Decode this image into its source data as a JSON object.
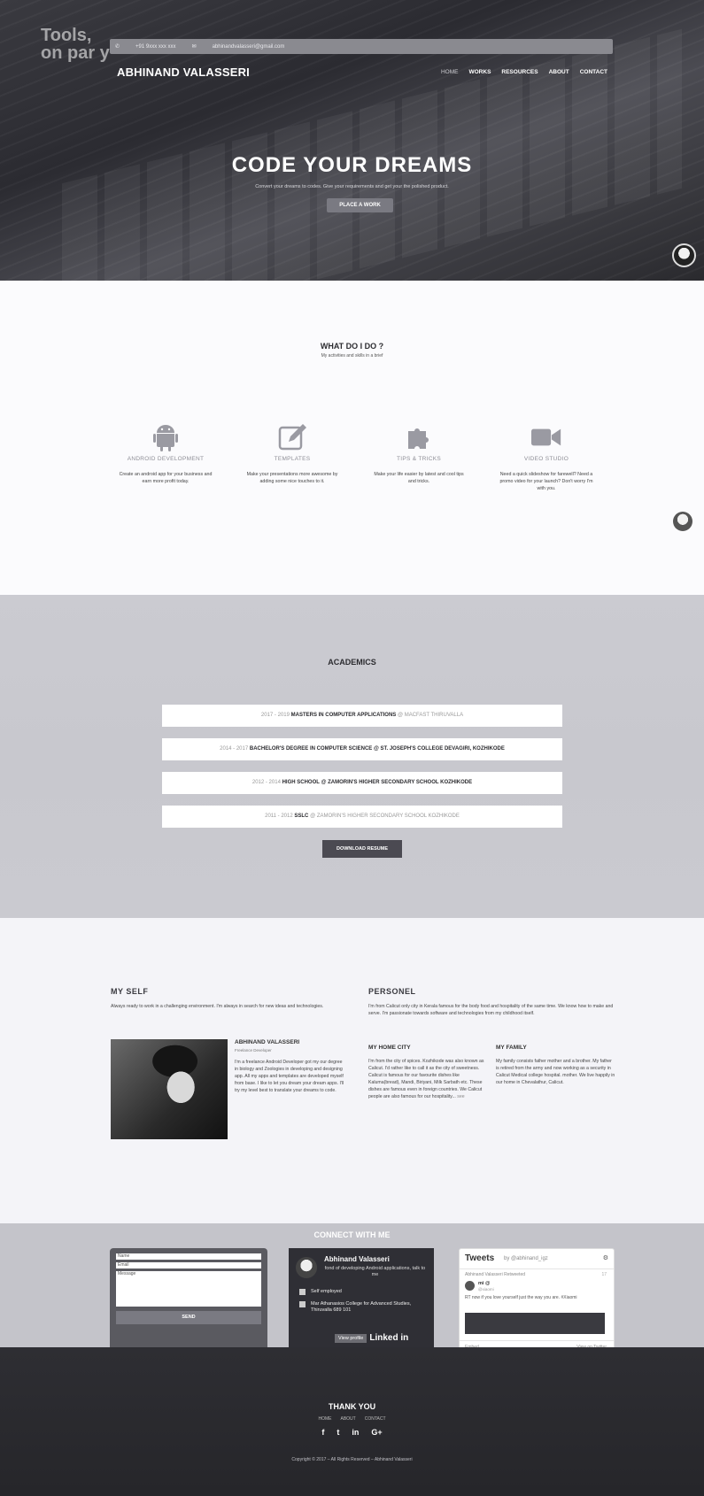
{
  "hero": {
    "bg_text": [
      "Tools,",
      "on par y"
    ],
    "topbar": {
      "phone": "+91 9xxx xxx xxx",
      "email": "abhinandvalasseri@gmail.com"
    },
    "brand": "ABHINAND VALASSERI",
    "nav": [
      "HOME",
      "WORKS",
      "RESOURCES",
      "ABOUT",
      "CONTACT"
    ],
    "title": "CODE YOUR DREAMS",
    "subtitle": "Convert your dreams to codes. Give your requirements and get your the polished product.",
    "cta": "PLACE A WORK"
  },
  "services": {
    "title": "WHAT DO I DO ?",
    "subtitle": "My activities and skills in a brief",
    "items": [
      {
        "icon": "android-icon",
        "name": "ANDROID DEVELOPMENT",
        "desc": "Create an android app for your business and earn more profit today."
      },
      {
        "icon": "edit-icon",
        "name": "TEMPLATES",
        "desc": "Make your presentations more awesome by adding some nice touches to it."
      },
      {
        "icon": "puzzle-icon",
        "name": "TIPS & TRICKS",
        "desc": "Make your life easier by latest and cool tips and tricks."
      },
      {
        "icon": "video-camera-icon",
        "name": "VIDEO STUDIO",
        "desc": "Need a quick slideshow for farewell? Need a promo video for your launch? Don't worry I'm with you."
      }
    ]
  },
  "academics": {
    "title": "ACADEMICS",
    "rows": [
      {
        "years": "2017 - 2019",
        "degree": "MASTERS IN COMPUTER APPLICATIONS",
        "place": "@ MACFAST THIRUVALLA"
      },
      {
        "years": "2014 - 2017",
        "degree": "BACHELOR'S DEGREE IN COMPUTER SCIENCE",
        "place": "@ ST. JOSEPH'S COLLEGE DEVAGIRI, KOZHIKODE"
      },
      {
        "years": "2012 - 2014",
        "degree": "HIGH SCHOOL",
        "place": "@ ZAMORIN'S HIGHER SECONDARY SCHOOL KOZHIKODE"
      },
      {
        "years": "2011 - 2012",
        "degree": "SSLC",
        "place": "@ ZAMORIN'S HIGHER SECONDARY SCHOOL KOZHIKODE"
      }
    ],
    "download": "DOWNLOAD RESUME"
  },
  "myself": {
    "title": "MY SELF",
    "intro": "Always ready to work in a challenging environment. I'm always in search for new ideas and technologies.",
    "name": "ABHINAND VALASSERI",
    "role": "Freelance Developer",
    "bio": "I'm a freelance Android Developer got my our degree in biology and Zoologies in developing and designing app. All my apps and templates are developed myself from base. I like to let you dream your dream apps. I'll try my level best to translate your dreams to code."
  },
  "personel": {
    "title": "PERSONEL",
    "intro": "I'm from Calicut only city in Kerala famous for the body food and hospitality of the same time. We know how to make and serve. I'm passionate towards software and technologies from my childhood itself.",
    "city_title": "MY HOME CITY",
    "city_text": "I'm from the city of spices. Kozhikode was also known as Calicut. I'd rather like to call it as the city of sweetness. Calicut is famous for our favourite dishes like Kaluma(bread), Mandi, Biriyani, Milk Sarbath etc. These dishes are famous even in foreign countries. We Calicut people are also famous for our hospitality...",
    "more": "see",
    "family_title": "MY FAMILY",
    "family_text": "My family consists father mother and a brother. My father is retired from the army and now working as a security in Calicut Medical college hospital. mother. We live happily in our home in Chevalathur, Calicut."
  },
  "connect": {
    "title": "CONNECT WITH ME",
    "form": {
      "name": "Name",
      "email": "Email",
      "message": "Message",
      "send": "SEND"
    },
    "linkedin": {
      "name": "Abhinand Valasseri",
      "tagline": "fond of developing Android applications, talk to me",
      "employment": "Self employed",
      "education": "Mar Athanasios College for Advanced Studies, Thiruvalla 689 101",
      "view": "View profile",
      "brand": "Linked in"
    },
    "twitter": {
      "heading": "Tweets",
      "handle": "by @abhinand_igz",
      "retweet": "Abhinand Valasseri Retweeted",
      "time": "17",
      "user": "mi @",
      "user_sub": "@xiaomi",
      "text": "RT now if you love yourself just the way you are. #Xiaomi",
      "embed": "Embed",
      "view": "View on Twitter"
    }
  },
  "footer": {
    "title": "THANK YOU",
    "links": [
      "HOME",
      "ABOUT",
      "CONTACT"
    ],
    "social": [
      "f",
      "t",
      "in",
      "G+"
    ],
    "copyright": "Copyright © 2017 – All Rights Reserved – Abhinand Valasseri"
  },
  "colors": {
    "hero_dark": "#2b2b31",
    "academics_bg": "#c9c9cf",
    "footer_bg": "#2a2a2e",
    "accent_btn": "#4b4a52"
  }
}
